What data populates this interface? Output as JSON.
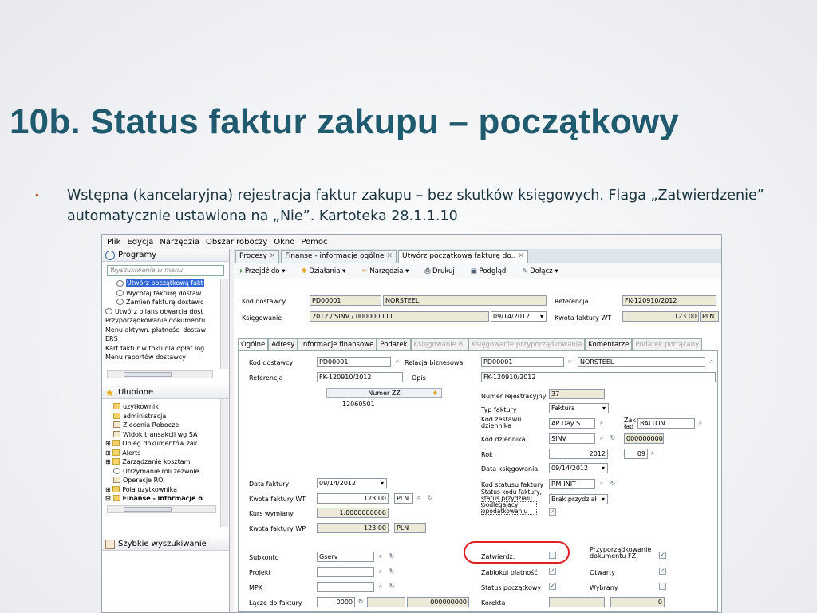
{
  "slide": {
    "title": "10b. Status faktur zakupu – początkowy",
    "bullet": "Wstępna (kancelaryjna) rejestracja faktur zakupu – bez skutków księgowych. Flaga „Zatwierdzenie” automatycznie ustawiona na „Nie”. Kartoteka 28.1.1.10"
  },
  "menu": [
    "Plik",
    "Edycja",
    "Narzędzia",
    "Obszar roboczy",
    "Okno",
    "Pomoc"
  ],
  "left": {
    "programs_title": "Programy",
    "search_placeholder": "Wyszukiwanie w menu",
    "program_items": [
      "Utwórz początkową fakt",
      "Wycofaj fakturę dostaw",
      "Zamień fakturę dostawc",
      "Utwórz bilans otwarcia dost",
      "Przyporządkowanie dokumentu",
      "Menu aktywn. płatności dostaw",
      "ERS",
      "Kart faktur w toku dla opłat log",
      "Menu raportów dostawcy"
    ],
    "favorites_title": "Ulubione",
    "favorite_items": [
      "uzytkownik",
      "administracja",
      "Zlecenia Robocze",
      "Widok transakcji wg SA",
      "Obieg dokumentów zak",
      "Alerts",
      "Zarządzanie kosztami",
      "Utrzymanie roli zezwole",
      "Operacje RO",
      "Pola uzytkownika",
      "Finanse - informacje o"
    ],
    "quick_search_title": "Szybkie wyszukiwanie"
  },
  "doctabs": [
    "Procesy",
    "Finanse - informacje ogólne",
    "Utwórz początkową fakturę do.."
  ],
  "toolbar": [
    "Przejdź do ▾",
    "Działania ▾",
    "Narzędzia ▾",
    "Drukuj",
    "Podgląd",
    "Dołącz ▾"
  ],
  "header": {
    "kod_dostawcy_label": "Kod dostawcy",
    "kod_dostawcy": "PD00001",
    "nazwa": "NORSTEEL",
    "referencja_label": "Referencja",
    "referencja": "FK-120910/2012",
    "ksiegowanie_label": "Księgowanie",
    "ksiegowanie": "2012 / SINV / 000000000",
    "data": "09/14/2012",
    "kwota_label": "Kwota faktury WT",
    "kwota": "123.00",
    "waluta": "PLN"
  },
  "subtabs": [
    "Ogólne",
    "Adresy",
    "Informacje finansowe",
    "Podatek",
    "Księgowanie BI",
    "Księgowanie przyporządkowania",
    "Komentarze",
    "Podatek potrącany"
  ],
  "form": {
    "kod_dostawcy_label": "Kod dostawcy",
    "kod_dostawcy": "PD00001",
    "relacja_label": "Relacja biznesowa",
    "relacja_kod": "PD00001",
    "relacja_nazwa": "NORSTEEL",
    "referencja_label": "Referencja",
    "referencja": "FK-120910/2012",
    "opis_label": "Opis",
    "opis": "FK-120910/2012",
    "numer_zz_header": "Numer ZZ",
    "numer_zz_value": "12060501",
    "nr_rej_label": "Numer rejestracyjny",
    "nr_rej": "37",
    "typ_label": "Typ faktury",
    "typ": "Faktura",
    "kod_zestawu_label": "Kod zestawu dziennika",
    "kod_zestawu": "AP Day S",
    "zak_lad_label": "Zak ład",
    "zak_lad": "BALTON",
    "kod_dziennika_label": "Kod dziennika",
    "kod_dziennika": "SINV",
    "kod_dziennika_nr": "000000000",
    "rok_label": "Rok",
    "rok": "2012",
    "rok_okres": "09",
    "data_ksieg_label": "Data księgowania",
    "data_ksieg": "09/14/2012",
    "data_faktury_label": "Data faktury",
    "data_faktury": "09/14/2012",
    "kod_statusu_label": "Kod statusu faktury",
    "kod_statusu": "RM-INIT",
    "kwota_wt_label": "Kwota faktury WT",
    "kwota_wt": "123.00",
    "waluta": "PLN",
    "status_kodu_label": "Status kodu faktury, status przydziału",
    "status_kodu": "Brak przydział",
    "kurs_label": "Kurs wymiany",
    "kurs": "1.0000000000",
    "podlegajacy_label": "podlegający opodatkowaniu",
    "kwota_wp_label": "Kwota faktury WP",
    "kwota_wp": "123.00",
    "waluta_wp": "PLN",
    "subkonto_label": "Subkonto",
    "subkonto": "Gserv",
    "projekt_label": "Projekt",
    "mpk_label": "MPK",
    "lacze_label": "Łącze do faktury",
    "lacze_a": "0000",
    "lacze_b": "000000000",
    "zatwierdz_label": "Zatwierdz.",
    "zablokuj_label": "Zablokuj płatność",
    "status_pocz_label": "Status początkowy",
    "korekta_label": "Korekta",
    "korekta": "0",
    "przyporz_label": "Przyporządkowanie dokumentu FZ",
    "otwarty_label": "Otwarty",
    "wybrany_label": "Wybrany"
  }
}
